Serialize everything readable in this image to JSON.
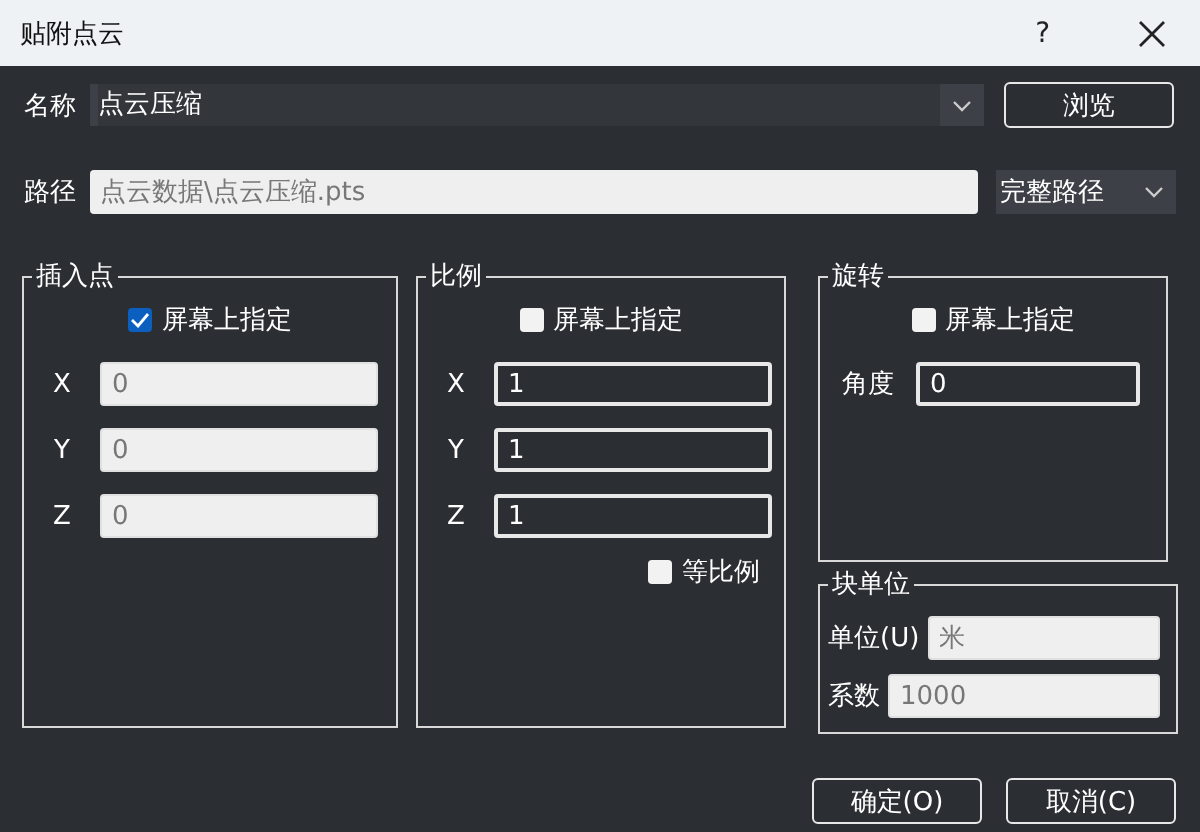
{
  "window": {
    "title": "贴附点云",
    "help": "?"
  },
  "name_field": {
    "label": "名称",
    "value": "点云压缩"
  },
  "browse_button": "浏览",
  "path_field": {
    "label": "路径",
    "value": "点云数据\\点云压缩.pts"
  },
  "path_mode": {
    "value": "完整路径"
  },
  "insertion": {
    "title": "插入点",
    "on_screen": {
      "label": "屏幕上指定",
      "checked": true
    },
    "fields": [
      {
        "label": "X",
        "value": "0",
        "disabled": true
      },
      {
        "label": "Y",
        "value": "0",
        "disabled": true
      },
      {
        "label": "Z",
        "value": "0",
        "disabled": true
      }
    ]
  },
  "scale": {
    "title": "比例",
    "on_screen": {
      "label": "屏幕上指定",
      "checked": false
    },
    "fields": [
      {
        "label": "X",
        "value": "1",
        "disabled": false
      },
      {
        "label": "Y",
        "value": "1",
        "disabled": false
      },
      {
        "label": "Z",
        "value": "1",
        "disabled": false
      }
    ],
    "uniform": {
      "label": "等比例",
      "checked": false
    }
  },
  "rotation": {
    "title": "旋转",
    "on_screen": {
      "label": "屏幕上指定",
      "checked": false
    },
    "angle": {
      "label": "角度",
      "value": "0",
      "disabled": false
    }
  },
  "units": {
    "title": "块单位",
    "fields": [
      {
        "label": "单位(U)",
        "value": "米",
        "disabled": true
      },
      {
        "label": "系数",
        "value": "1000",
        "disabled": true
      }
    ]
  },
  "buttons": [
    "确定(O)",
    "取消(C)"
  ]
}
